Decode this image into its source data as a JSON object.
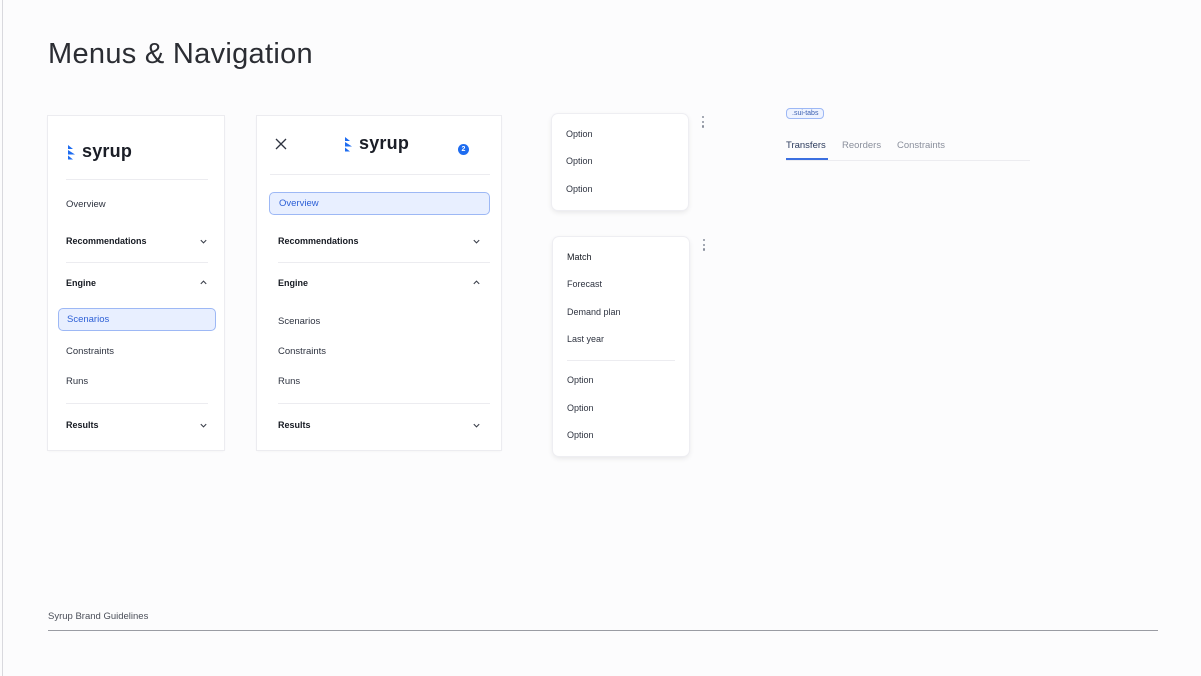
{
  "page": {
    "title": "Menus & Navigation"
  },
  "brand": {
    "name": "syrup",
    "accent": "#1e6cf0"
  },
  "sidebar_expanded": {
    "items": {
      "overview": "Overview",
      "recommendations": "Recommendations",
      "engine": "Engine",
      "scenarios": "Scenarios",
      "constraints": "Constraints",
      "runs": "Runs",
      "results": "Results"
    },
    "active": "Scenarios"
  },
  "sidebar_mobile": {
    "notification_count": "2",
    "items": {
      "overview": "Overview",
      "recommendations": "Recommendations",
      "engine": "Engine",
      "scenarios": "Scenarios",
      "constraints": "Constraints",
      "runs": "Runs",
      "results": "Results"
    },
    "active": "Overview"
  },
  "menu_simple": {
    "items": [
      "Option",
      "Option",
      "Option"
    ]
  },
  "menu_grouped": {
    "group1": [
      "Match",
      "Forecast",
      "Demand plan",
      "Last year"
    ],
    "group2": [
      "Option",
      "Option",
      "Option"
    ]
  },
  "tabs": {
    "class_tag": ".sui-tabs",
    "items": [
      "Transfers",
      "Reorders",
      "Constraints"
    ],
    "active": "Transfers"
  },
  "footer": {
    "text": "Syrup Brand Guidelines"
  }
}
